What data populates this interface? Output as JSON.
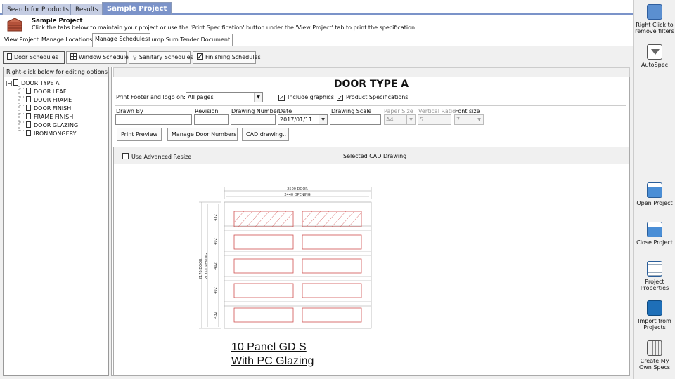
{
  "app_tabs": [
    "Search for Products",
    "Results",
    "Sample Project"
  ],
  "header": {
    "title": "Sample Project",
    "subtitle": "Click the tabs below to maintain your project or use the 'Print Specification' button under the 'View Project' tab to print the specification."
  },
  "sub_tabs": [
    "View Project",
    "Manage Locations",
    "Manage Schedules",
    "Lump Sum Tender Document"
  ],
  "schedule_buttons": [
    "Door Schedules",
    "Window Schedules",
    "Sanitary Schedules",
    "Finishing Schedules"
  ],
  "left_panel": {
    "header": "Right-click below for editing options",
    "root": "DOOR TYPE A",
    "children": [
      "DOOR LEAF",
      "DOOR FRAME",
      "DOOR FINISH",
      "FRAME FINISH",
      "DOOR GLAZING",
      "IRONMONGERY"
    ]
  },
  "form": {
    "title": "DOOR TYPE A",
    "print_footer_label": "Print Footer and logo on:",
    "print_footer_value": "All pages",
    "include_graphics_label": "Include graphics",
    "product_specs_label": "Product Specifications",
    "drawn_by_label": "Drawn By",
    "revision_label": "Revision",
    "drawing_number_label": "Drawing Number",
    "date_label": "Date",
    "date_value": "2017/01/11",
    "drawing_scale_label": "Drawing Scale",
    "paper_size_label": "Paper Size",
    "paper_size_value": "A4",
    "vertical_ratio_label": "Vertical Ratio",
    "vertical_ratio_value": "5",
    "font_size_label": "Font size",
    "font_size_value": "7",
    "print_preview": "Print Preview",
    "manage_door_numbers": "Manage Door Numbers",
    "cad_drawing": "CAD drawing.."
  },
  "cad": {
    "advanced_resize_label": "Use Advanced Resize",
    "selected_label": "Selected CAD Drawing",
    "dim_top_1": "2500 DOOR",
    "dim_top_2": "2440 OPENING",
    "dim_left_1": "2170 DOOR",
    "dim_left_2": "2135 OPENING",
    "panel_dims": [
      "432",
      "402",
      "402",
      "402",
      "432"
    ],
    "caption_1": "10 Panel GD S",
    "caption_2": "With PC Glazing"
  },
  "right_panel": {
    "remove_filters": "Right Click to remove filters",
    "autospec": "AutoSpec",
    "open_project": "Open Project",
    "close_project": "Close Project",
    "project_properties": "Project Properties",
    "import_projects": "Import from Projects",
    "create_specs": "Create My Own Specs"
  }
}
